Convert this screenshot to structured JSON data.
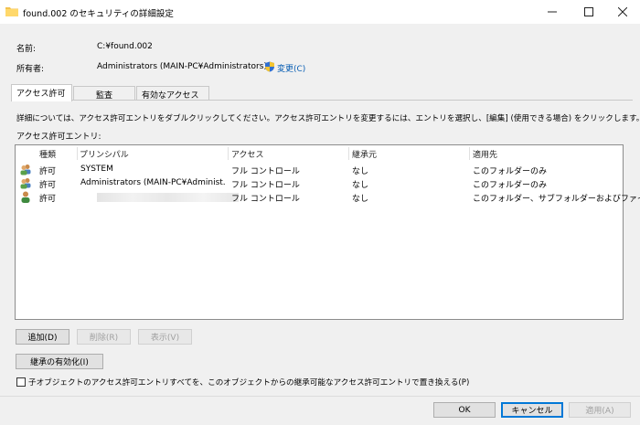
{
  "window": {
    "title": "found.002 のセキュリティの詳細設定",
    "icons": {
      "title": "folder-icon",
      "minimize": "minimize-icon",
      "maximize": "maximize-icon",
      "close": "close-icon"
    }
  },
  "info": {
    "name_label": "名前:",
    "name_value": "C:¥found.002",
    "owner_label": "所有者:",
    "owner_value": "Administrators (MAIN-PC¥Administrators)",
    "change_link": "変更(C)",
    "change_icon": "shield-icon"
  },
  "tabs": [
    {
      "label": "アクセス許可",
      "active": true
    },
    {
      "label": "監査",
      "active": false
    },
    {
      "label": "有効なアクセス",
      "active": false
    }
  ],
  "description": "詳細については、アクセス許可エントリをダブルクリックしてください。アクセス許可エントリを変更するには、エントリを選択し、[編集] (使用できる場合) をクリックします。",
  "list_label": "アクセス許可エントリ:",
  "columns": [
    "種類",
    "プリンシパル",
    "アクセス",
    "継承元",
    "適用先"
  ],
  "entries": [
    {
      "icon": "group-icon",
      "type": "許可",
      "principal": "SYSTEM",
      "access": "フル コントロール",
      "inherited": "なし",
      "applies": "このフォルダーのみ"
    },
    {
      "icon": "group-icon",
      "type": "許可",
      "principal": "Administrators (MAIN-PC¥Administ...",
      "access": "フル コントロール",
      "inherited": "なし",
      "applies": "このフォルダーのみ"
    },
    {
      "icon": "user-icon",
      "type": "許可",
      "principal": "",
      "access": "フル コントロール",
      "inherited": "なし",
      "applies": "このフォルダー、サブフォルダーおよびファイル"
    }
  ],
  "buttons": {
    "add": "追加(D)",
    "remove": "削除(R)",
    "view": "表示(V)",
    "inheritance": "継承の有効化(I)"
  },
  "replace_checkbox": {
    "label": "子オブジェクトのアクセス許可エントリすべてを、このオブジェクトからの継承可能なアクセス許可エントリで置き換える(P)",
    "checked": false
  },
  "footer": {
    "ok": "OK",
    "cancel": "キャンセル",
    "apply": "適用(A)"
  },
  "colors": {
    "accent": "#0078d7",
    "link": "#0a5fb4",
    "disabled_text": "#a0a0a0"
  }
}
